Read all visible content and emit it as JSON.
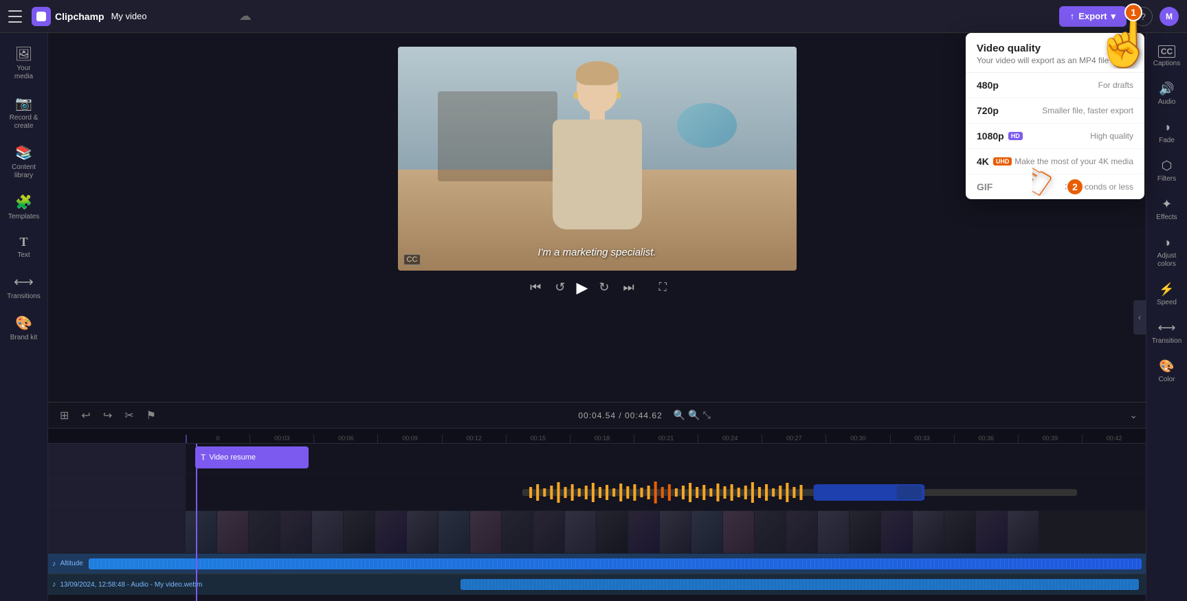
{
  "app": {
    "name": "Clipchamp",
    "title": "My video",
    "export_label": "Export"
  },
  "topbar": {
    "help_label": "?",
    "avatar_label": "M"
  },
  "left_sidebar": {
    "items": [
      {
        "id": "your-media",
        "icon": "🖼",
        "label": "Your media"
      },
      {
        "id": "record-create",
        "icon": "📷",
        "label": "Record & create"
      },
      {
        "id": "content-library",
        "icon": "📚",
        "label": "Content library"
      },
      {
        "id": "templates",
        "icon": "🧩",
        "label": "Templates"
      },
      {
        "id": "text",
        "icon": "T",
        "label": "Text"
      },
      {
        "id": "transitions",
        "icon": "⟷",
        "label": "Transitions"
      },
      {
        "id": "brand-kit",
        "icon": "🎨",
        "label": "Brand kit"
      }
    ]
  },
  "right_sidebar": {
    "items": [
      {
        "id": "captions",
        "icon": "CC",
        "label": "Captions"
      },
      {
        "id": "audio",
        "icon": "🔊",
        "label": "Audio"
      },
      {
        "id": "fade",
        "icon": "◑",
        "label": "Fade"
      },
      {
        "id": "filters",
        "icon": "◈",
        "label": "Filters"
      },
      {
        "id": "effects",
        "icon": "✨",
        "label": "Effects"
      },
      {
        "id": "adjust-colors",
        "icon": "🎨",
        "label": "Adjust colors"
      },
      {
        "id": "speed",
        "icon": "⚡",
        "label": "Speed"
      },
      {
        "id": "transition",
        "icon": "⟷",
        "label": "Transition"
      },
      {
        "id": "color",
        "icon": "🎨",
        "label": "Color"
      }
    ]
  },
  "video": {
    "subtitle": "I'm a marketing specialist.",
    "time_current": "00:04.54",
    "time_total": "00:44.62"
  },
  "export_dropdown": {
    "title": "Video quality",
    "subtitle": "Your video will export as an MP4 file",
    "options": [
      {
        "res": "480p",
        "badge": null,
        "desc": "For drafts"
      },
      {
        "res": "720p",
        "badge": null,
        "desc": "Smaller file, faster export"
      },
      {
        "res": "1080p",
        "badge": "HD",
        "badge_type": "hd",
        "desc": "High quality"
      },
      {
        "res": "4K",
        "badge": "UHD",
        "badge_type": "uhd",
        "desc": "Make the most of your 4K media"
      },
      {
        "res": "GIF",
        "badge": null,
        "desc": "30 seconds or less"
      }
    ]
  },
  "timeline": {
    "time_display": "00:04.54 / 00:44.62",
    "ruler_marks": [
      "0",
      "00:03",
      "00:06",
      "00:09",
      "00:12",
      "00:15",
      "00:18",
      "00:21",
      "00:24",
      "00:27",
      "00:30",
      "00:33",
      "00:36",
      "00:39",
      "00:42"
    ],
    "clips": [
      {
        "label": "Video resume",
        "type": "video",
        "color": "#7c5af0",
        "icon": "T"
      }
    ],
    "music_track": "Altitude",
    "audio_tracks": [
      "13/09/2024, 12:58:48 - Audio - My video.webm",
      "13/09/2024, 12:58:48 - Audio - My video",
      "13/09/2024, 12:58:48 - Audio"
    ]
  },
  "cursor_annotations": {
    "step1_label": "1",
    "step2_label": "2"
  }
}
